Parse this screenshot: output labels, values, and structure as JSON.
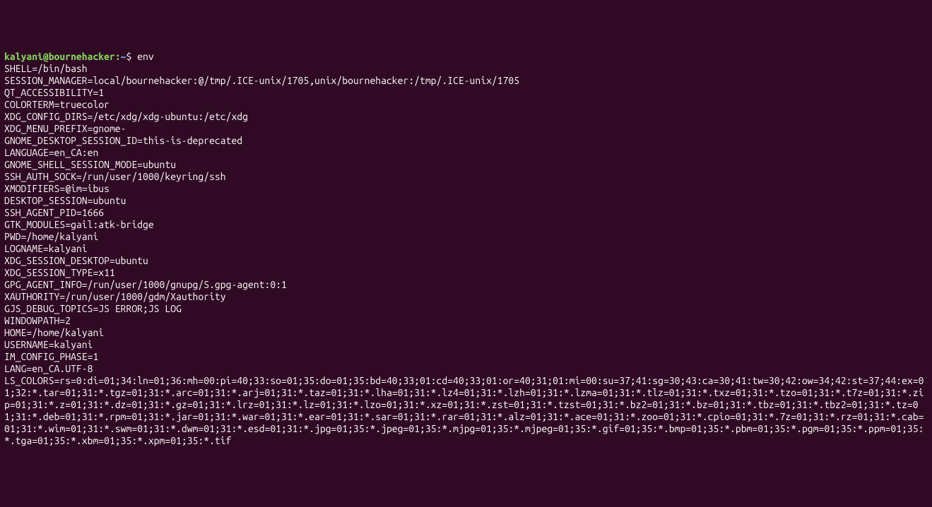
{
  "prompt": {
    "user_host": "kalyani@bournehacker",
    "colon": ":",
    "path": "~",
    "dollar": "$ ",
    "command": "env"
  },
  "lines": [
    "SHELL=/bin/bash",
    "SESSION_MANAGER=local/bournehacker:@/tmp/.ICE-unix/1705,unix/bournehacker:/tmp/.ICE-unix/1705",
    "QT_ACCESSIBILITY=1",
    "COLORTERM=truecolor",
    "XDG_CONFIG_DIRS=/etc/xdg/xdg-ubuntu:/etc/xdg",
    "XDG_MENU_PREFIX=gnome-",
    "GNOME_DESKTOP_SESSION_ID=this-is-deprecated",
    "LANGUAGE=en_CA:en",
    "GNOME_SHELL_SESSION_MODE=ubuntu",
    "SSH_AUTH_SOCK=/run/user/1000/keyring/ssh",
    "XMODIFIERS=@im=ibus",
    "DESKTOP_SESSION=ubuntu",
    "SSH_AGENT_PID=1666",
    "GTK_MODULES=gail:atk-bridge",
    "PWD=/home/kalyani",
    "LOGNAME=kalyani",
    "XDG_SESSION_DESKTOP=ubuntu",
    "XDG_SESSION_TYPE=x11",
    "GPG_AGENT_INFO=/run/user/1000/gnupg/S.gpg-agent:0:1",
    "XAUTHORITY=/run/user/1000/gdm/Xauthority",
    "GJS_DEBUG_TOPICS=JS ERROR;JS LOG",
    "WINDOWPATH=2",
    "HOME=/home/kalyani",
    "USERNAME=kalyani",
    "IM_CONFIG_PHASE=1",
    "LANG=en_CA.UTF-8",
    "LS_COLORS=rs=0:di=01;34:ln=01;36:mh=00:pi=40;33:so=01;35:do=01;35:bd=40;33;01:cd=40;33;01:or=40;31;01:mi=00:su=37;41:sg=30;43:ca=30;41:tw=30;42:ow=34;42:st=37;44:ex=01;32:*.tar=01;31:*.tgz=01;31:*.arc=01;31:*.arj=01;31:*.taz=01;31:*.lha=01;31:*.lz4=01;31:*.lzh=01;31:*.lzma=01;31:*.tlz=01;31:*.txz=01;31:*.tzo=01;31:*.t7z=01;31:*.zip=01;31:*.z=01;31:*.dz=01;31:*.gz=01;31:*.lrz=01;31:*.lz=01;31:*.lzo=01;31:*.xz=01;31:*.zst=01;31:*.tzst=01;31:*.bz2=01;31:*.bz=01;31:*.tbz=01;31:*.tbz2=01;31:*.tz=01;31:*.deb=01;31:*.rpm=01;31:*.jar=01;31:*.war=01;31:*.ear=01;31:*.sar=01;31:*.rar=01;31:*.alz=01;31:*.ace=01;31:*.zoo=01;31:*.cpio=01;31:*.7z=01;31:*.rz=01;31:*.cab=01;31:*.wim=01;31:*.swm=01;31:*.dwm=01;31:*.esd=01;31:*.jpg=01;35:*.jpeg=01;35:*.mjpg=01;35:*.mjpeg=01;35:*.gif=01;35:*.bmp=01;35:*.pbm=01;35:*.pgm=01;35:*.ppm=01;35:*.tga=01;35:*.xbm=01;35:*.xpm=01;35:*.tif"
  ]
}
